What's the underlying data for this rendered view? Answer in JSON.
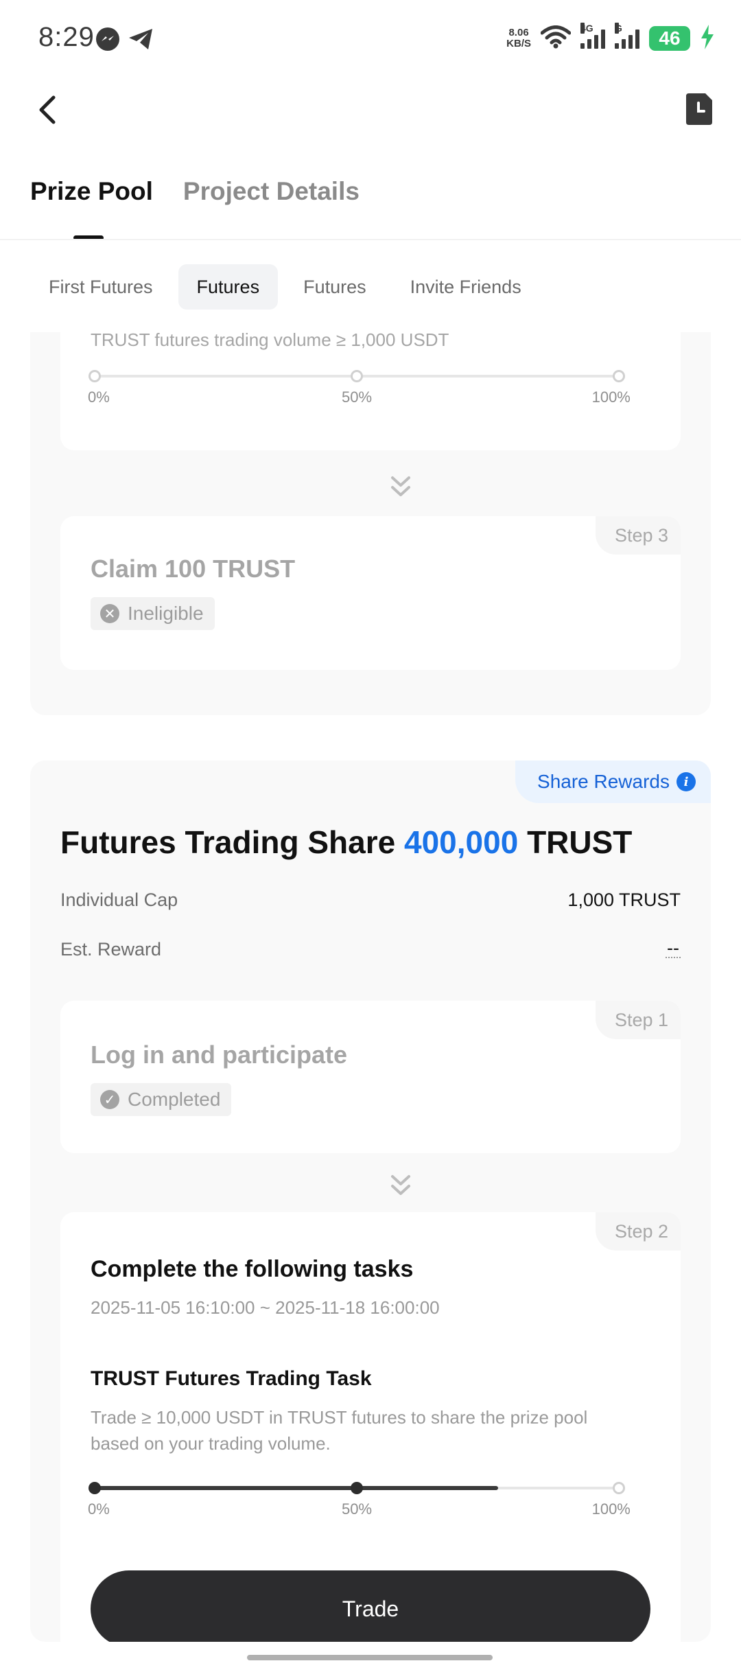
{
  "status_bar": {
    "time": "8:29",
    "net_speed_value": "8.06",
    "net_speed_unit": "KB/S",
    "network_1": "4G",
    "network_2": "G",
    "battery": "46",
    "colors": {
      "battery": "#34c26e"
    }
  },
  "header": {
    "back_icon": "chevron-left-icon",
    "history_icon": "history-doc-icon"
  },
  "main_tabs": [
    {
      "label": "Prize Pool",
      "active": true
    },
    {
      "label": "Project Details",
      "active": false
    }
  ],
  "sub_tabs": [
    {
      "label": "First Futures",
      "active": false
    },
    {
      "label": "Futures",
      "active": true
    },
    {
      "label": "Futures",
      "active": false
    },
    {
      "label": "Invite Friends",
      "active": false
    }
  ],
  "card_one": {
    "partial_text": "TRUST futures trading volume ≥ 1,000 USDT",
    "progress": {
      "value": 0,
      "labels": [
        "0%",
        "50%",
        "100%"
      ]
    },
    "step3": {
      "tag": "Step 3",
      "title": "Claim 100 TRUST",
      "status": "Ineligible"
    }
  },
  "card_two": {
    "share_rewards_label": "Share Rewards",
    "title_prefix": "Futures Trading Share",
    "title_amount": "400,000",
    "title_suffix": "TRUST",
    "individual_cap_label": "Individual Cap",
    "individual_cap_value": "1,000 TRUST",
    "est_reward_label": "Est. Reward",
    "est_reward_value": "--",
    "step1": {
      "tag": "Step 1",
      "title": "Log in and participate",
      "status": "Completed"
    },
    "step2": {
      "tag": "Step 2",
      "title": "Complete the following tasks",
      "date_range": "2025-11-05 16:10:00 ~ 2025-11-18 16:00:00",
      "task_title": "TRUST Futures Trading Task",
      "task_desc": "Trade ≥ 10,000 USDT in TRUST futures to share the prize pool based on your trading volume.",
      "progress": {
        "value": 0.77,
        "labels": [
          "0%",
          "50%",
          "100%"
        ]
      }
    },
    "trade_button": "Trade",
    "colors": {
      "accent": "#1a73e8",
      "button": "#2c2c2e"
    }
  }
}
